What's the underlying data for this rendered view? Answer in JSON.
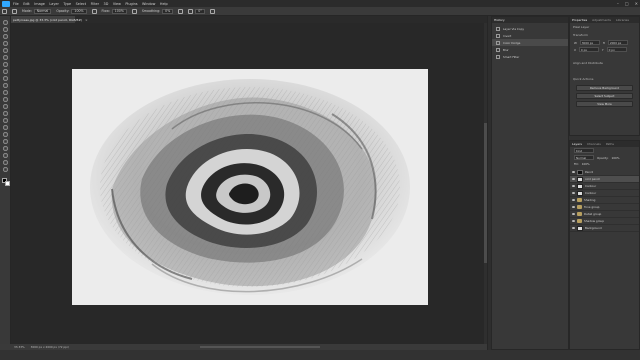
{
  "menu": {
    "items": [
      "File",
      "Edit",
      "Image",
      "Layer",
      "Type",
      "Select",
      "Filter",
      "3D",
      "View",
      "Plugins",
      "Window",
      "Help"
    ],
    "window_controls": [
      "–",
      "□",
      "✕"
    ]
  },
  "options": {
    "mode_label": "Mode:",
    "mode_value": "Normal",
    "opacity_label": "Opacity:",
    "opacity_value": "100%",
    "flow_label": "Flow:",
    "flow_value": "100%",
    "smoothing_label": "Smoothing:",
    "smoothing_value": "0%",
    "angle_value": "0°"
  },
  "document": {
    "tab_title": "pettyrosas.jpg @ 33.3% (cold pencil, RGB/8#)",
    "tab_close": "×"
  },
  "status": {
    "zoom": "33.33%",
    "doc_info": "3000 px x 2000 px (72 ppi)"
  },
  "history": {
    "tab": "History",
    "items": [
      {
        "label": "Layer Via Copy"
      },
      {
        "label": "Invert"
      },
      {
        "label": "Color Dodge"
      },
      {
        "label": "Blur"
      },
      {
        "label": "Smart Filter"
      }
    ]
  },
  "properties": {
    "tabs": [
      "Properties",
      "Adjustments",
      "Libraries"
    ],
    "pixel_layer": "Pixel Layer",
    "transform_label": "Transform",
    "w_label": "W",
    "w_value": "3000 px",
    "h_label": "H",
    "h_value": "2000 px",
    "x_label": "X",
    "x_value": "0 px",
    "y_label": "Y",
    "y_value": "0 px",
    "align_label": "Align and Distribute",
    "quick_actions_label": "Quick Actions",
    "quick_actions": [
      "Remove Background",
      "Select Subject",
      "View More"
    ]
  },
  "layers": {
    "tabs": [
      "Layers",
      "Channels",
      "Paths"
    ],
    "kind_label": "Kind",
    "blend_mode": "Normal",
    "opacity_label": "Opacity:",
    "opacity_value": "100%",
    "fill_label": "Fill:",
    "fill_value": "100%",
    "items": [
      {
        "name": "Pencil"
      },
      {
        "name": "cold pencil"
      },
      {
        "name": "Contour"
      },
      {
        "name": "Contour"
      },
      {
        "name": "Shading"
      },
      {
        "name": "Tone group"
      },
      {
        "name": "Detail group"
      },
      {
        "name": "Shadow group"
      },
      {
        "name": "Background"
      }
    ]
  },
  "colors": {
    "accent": "#31a8ff",
    "canvas_bg": "#282828",
    "panel_bg": "#383838"
  }
}
